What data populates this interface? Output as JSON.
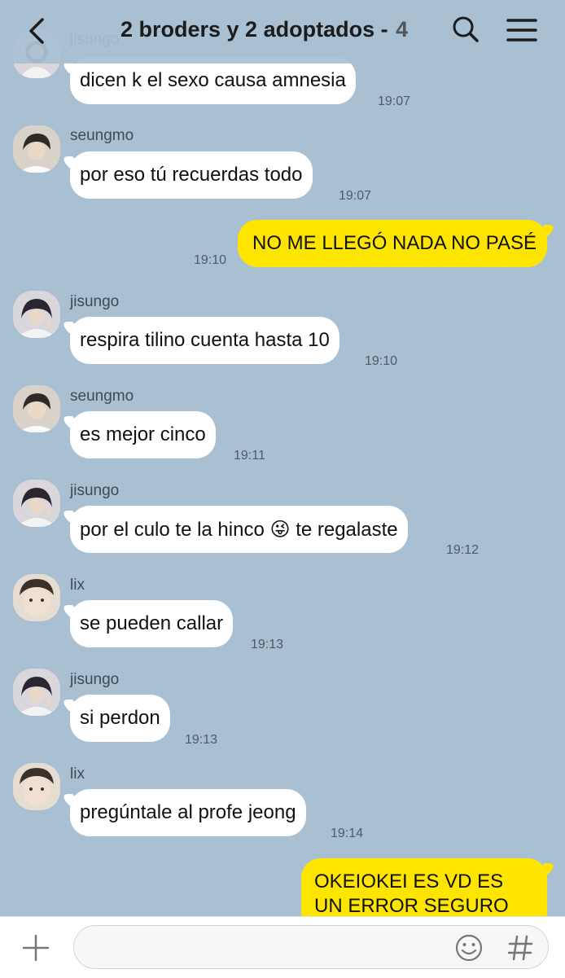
{
  "header": {
    "title": "2 broders y 2 adoptados -",
    "member_count": "4",
    "top_partial_sender": "jisungo"
  },
  "messages": [
    {
      "sender": "",
      "text": "dicen k el sexo causa amnesia",
      "time": "19:07",
      "avatar": "jisungo-avatar"
    },
    {
      "sender": "seungmo",
      "text": "por eso tú recuerdas todo",
      "time": "19:07"
    },
    {
      "sender": "me",
      "text": "NO ME LLEGÓ NADA NO PASÉ",
      "time": "19:10"
    },
    {
      "sender": "jisungo",
      "text": "respira tilino cuenta hasta 10",
      "time": "19:10"
    },
    {
      "sender": "seungmo",
      "text": "es mejor cinco",
      "time": "19:11"
    },
    {
      "sender": "jisungo",
      "text_before": "por el culo te la hinco",
      "emoji": "😜",
      "text_after": "te regalaste",
      "time": "19:12"
    },
    {
      "sender": "lix",
      "text": "se pueden callar",
      "time": "19:13"
    },
    {
      "sender": "jisungo",
      "text": "si perdon",
      "time": "19:13"
    },
    {
      "sender": "lix",
      "text": "pregúntale al profe jeong",
      "time": "19:14"
    },
    {
      "sender": "me",
      "text": "OKEIOKEI ES VD ES UN ERROR SEGURO",
      "time": ""
    }
  ],
  "input": {
    "placeholder": ""
  },
  "icons": {
    "back": "chevron-left-icon",
    "search": "search-icon",
    "menu": "hamburger-menu-icon",
    "plus": "plus-icon",
    "emoji": "emoji-icon",
    "hash": "hash-icon"
  },
  "colors": {
    "background": "#a9c0d3",
    "my_bubble": "#fee500",
    "their_bubble": "#ffffff"
  }
}
